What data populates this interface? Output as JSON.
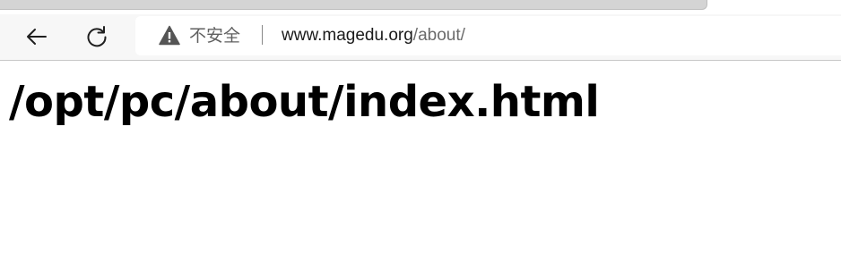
{
  "browser": {
    "icons": {
      "back": "back-arrow-icon",
      "reload": "reload-icon",
      "security": "warning-triangle-icon"
    },
    "address_bar": {
      "security_label": "不安全",
      "url_host": "www.magedu.org",
      "url_path": "/about/"
    }
  },
  "page": {
    "heading": "/opt/pc/about/index.html"
  }
}
